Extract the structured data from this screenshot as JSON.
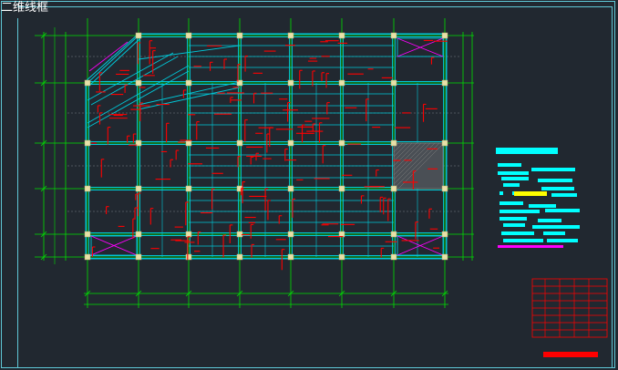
{
  "viewport": {
    "label": "二维线框"
  },
  "colors": {
    "background": "#212830",
    "viewport_frame": "#5fc7d6",
    "grid_lines": "#00e000",
    "beams": "#00c8d8",
    "rebar": "#ff0000",
    "columns": "#e8e0a8",
    "shaft_cross": "#ff00ff",
    "hatch": "#808080",
    "note_text": "#00ffff",
    "note_highlight": "#ffff00",
    "title_block": "#ff0000"
  },
  "icons": {
    "view_label": "none"
  }
}
